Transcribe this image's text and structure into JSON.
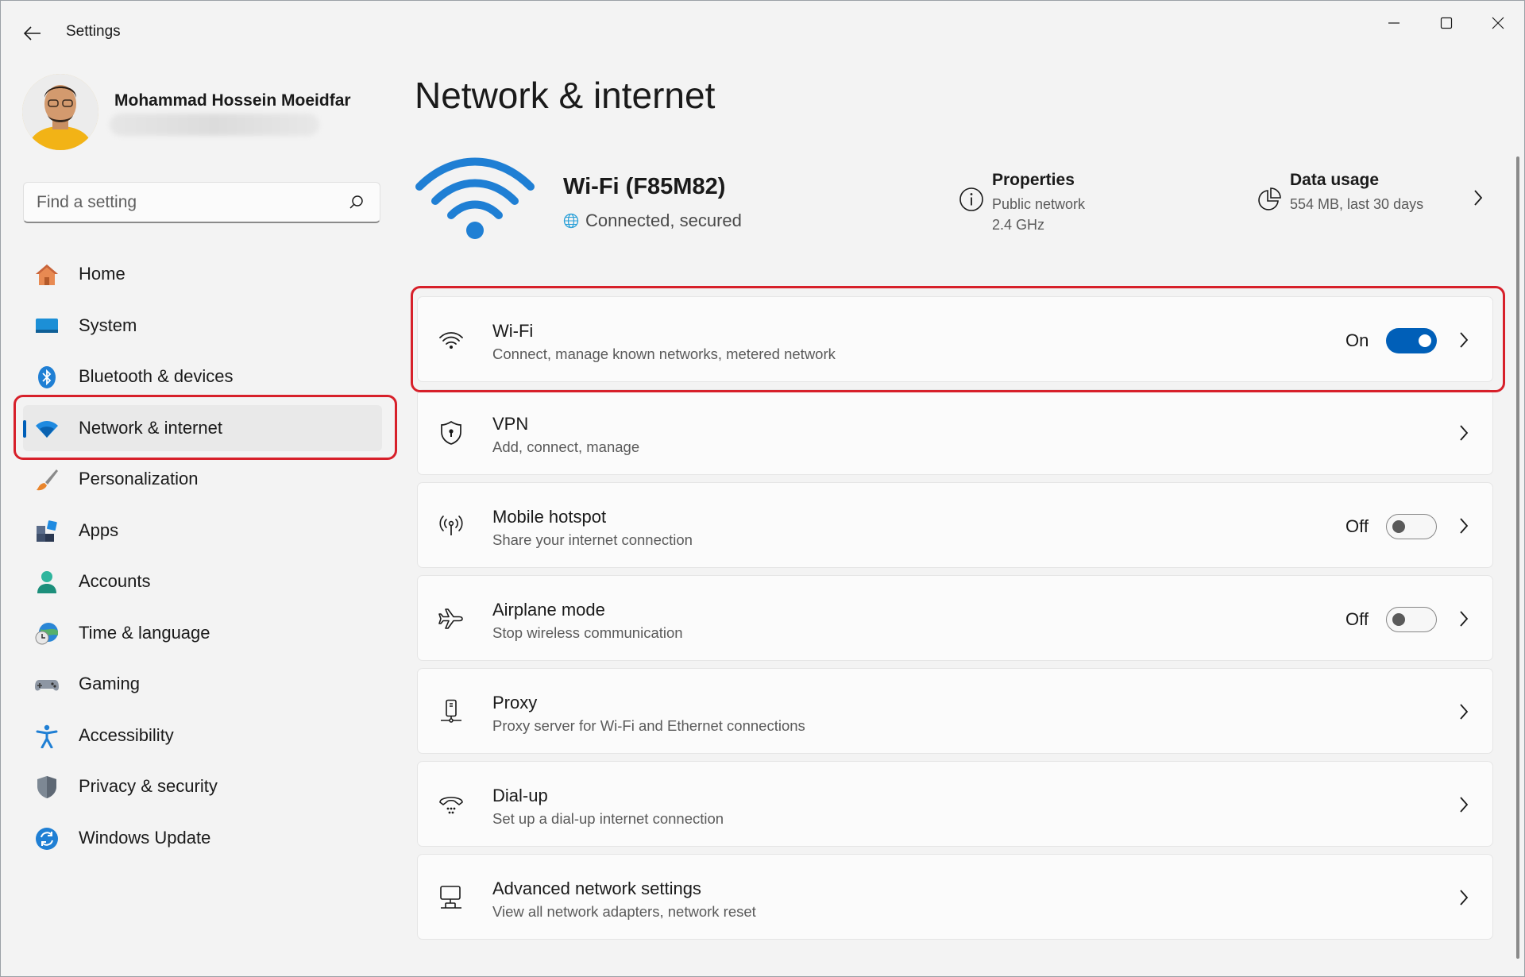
{
  "window": {
    "title": "Settings",
    "controls": {
      "minimize": "minimize-icon",
      "maximize": "maximize-icon",
      "close": "close-icon"
    }
  },
  "profile": {
    "name": "Mohammad Hossein Moeidfar"
  },
  "search": {
    "placeholder": "Find a setting"
  },
  "sidebar": {
    "items": [
      {
        "label": "Home",
        "icon": "home-icon"
      },
      {
        "label": "System",
        "icon": "system-icon"
      },
      {
        "label": "Bluetooth & devices",
        "icon": "bluetooth-icon"
      },
      {
        "label": "Network & internet",
        "icon": "network-icon",
        "active": true
      },
      {
        "label": "Personalization",
        "icon": "brush-icon"
      },
      {
        "label": "Apps",
        "icon": "apps-icon"
      },
      {
        "label": "Accounts",
        "icon": "accounts-icon"
      },
      {
        "label": "Time & language",
        "icon": "time-language-icon"
      },
      {
        "label": "Gaming",
        "icon": "gaming-icon"
      },
      {
        "label": "Accessibility",
        "icon": "accessibility-icon"
      },
      {
        "label": "Privacy & security",
        "icon": "shield-icon"
      },
      {
        "label": "Windows Update",
        "icon": "windows-update-icon"
      }
    ]
  },
  "main": {
    "title": "Network & internet",
    "connection": {
      "name": "Wi-Fi (F85M82)",
      "status": "Connected, secured"
    },
    "properties": {
      "title": "Properties",
      "line1": "Public network",
      "line2": "2.4 GHz"
    },
    "data_usage": {
      "title": "Data usage",
      "value": "554 MB, last 30 days"
    },
    "cards": [
      {
        "title": "Wi-Fi",
        "subtitle": "Connect, manage known networks, metered network",
        "icon": "wifi-icon",
        "toggle": "On"
      },
      {
        "title": "VPN",
        "subtitle": "Add, connect, manage",
        "icon": "vpn-shield-icon"
      },
      {
        "title": "Mobile hotspot",
        "subtitle": "Share your internet connection",
        "icon": "hotspot-icon",
        "toggle": "Off"
      },
      {
        "title": "Airplane mode",
        "subtitle": "Stop wireless communication",
        "icon": "airplane-icon",
        "toggle": "Off"
      },
      {
        "title": "Proxy",
        "subtitle": "Proxy server for Wi-Fi and Ethernet connections",
        "icon": "proxy-icon"
      },
      {
        "title": "Dial-up",
        "subtitle": "Set up a dial-up internet connection",
        "icon": "dialup-icon"
      },
      {
        "title": "Advanced network settings",
        "subtitle": "View all network adapters, network reset",
        "icon": "advanced-network-icon"
      }
    ]
  },
  "colors": {
    "accent": "#005fb8",
    "highlight": "#d7202a",
    "background": "#f3f3f3"
  }
}
